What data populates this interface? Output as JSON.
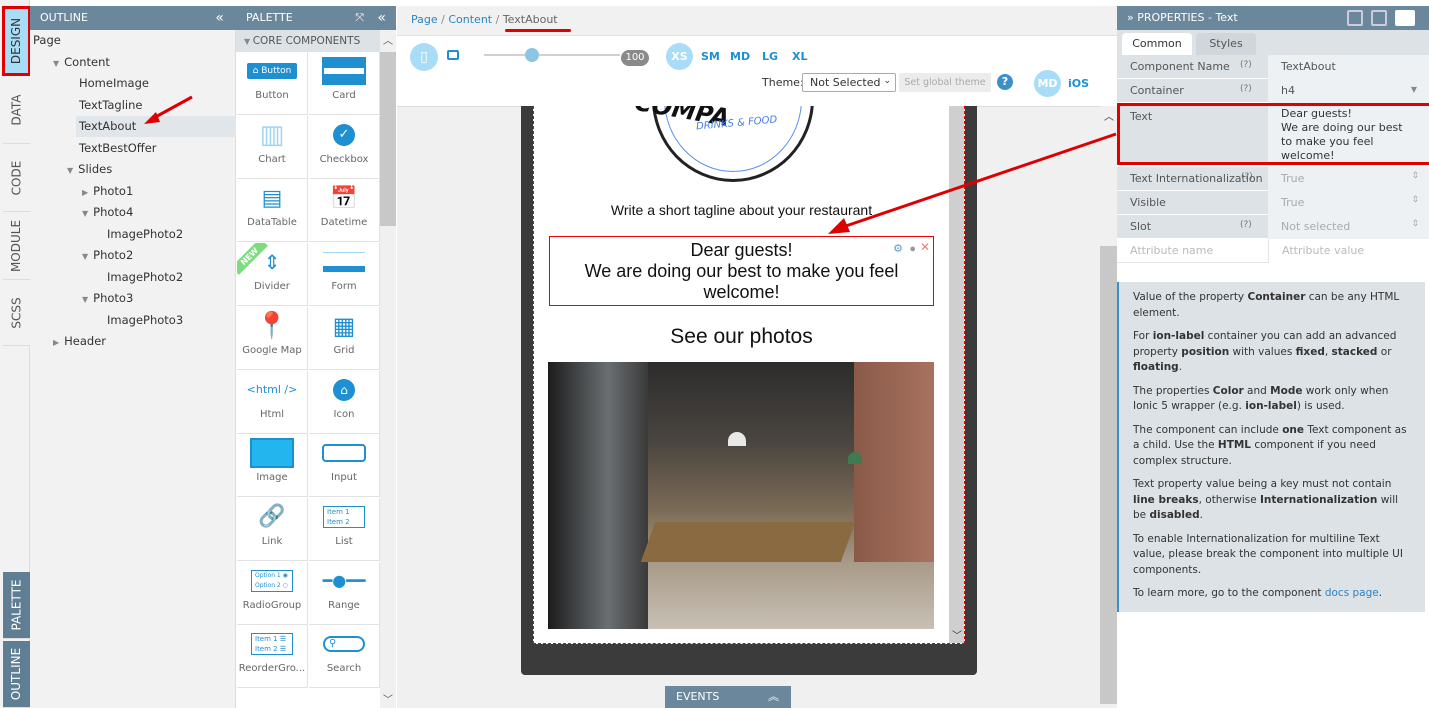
{
  "side_tabs": [
    "DESIGN",
    "DATA",
    "CODE",
    "MODULE",
    "SCSS"
  ],
  "bottom_tabs": [
    "PALETTE",
    "OUTLINE"
  ],
  "outline": {
    "title": "OUTLINE",
    "collapse": "«",
    "items": [
      {
        "label": "Page"
      },
      {
        "label": "Content"
      },
      {
        "label": "HomeImage"
      },
      {
        "label": "TextTagline"
      },
      {
        "label": "TextAbout"
      },
      {
        "label": "TextBestOffer"
      },
      {
        "label": "Slides"
      },
      {
        "label": "Photo1"
      },
      {
        "label": "Photo4"
      },
      {
        "label": "ImagePhoto2"
      },
      {
        "label": "Photo2"
      },
      {
        "label": "ImagePhoto2"
      },
      {
        "label": "Photo3"
      },
      {
        "label": "ImagePhoto3"
      },
      {
        "label": "Header"
      }
    ]
  },
  "palette": {
    "title": "PALETTE",
    "section": "CORE COMPONENTS",
    "items": [
      "Button",
      "Card",
      "Chart",
      "Checkbox",
      "DataTable",
      "Datetime",
      "Divider",
      "Form",
      "Google Map",
      "Grid",
      "Html",
      "Icon",
      "Image",
      "Input",
      "Link",
      "List",
      "RadioGroup",
      "Range",
      "ReorderGro...",
      "Search"
    ],
    "new_badge": "NEW",
    "html_glyph": "<html />",
    "button_glyph": "Button"
  },
  "breadcrumb": [
    "Page",
    "Content",
    "TextAbout"
  ],
  "toolbar": {
    "zoom": "100",
    "zoom_fraction": 0.35,
    "sizes": [
      "XS",
      "SM",
      "MD",
      "LG",
      "XL"
    ],
    "theme_label": "Theme:",
    "theme_value": "Not Selected",
    "set_theme": "Set global theme",
    "modes": [
      "MD",
      "iOS"
    ]
  },
  "canvas": {
    "logo_sub": "DRINKS & FOOD",
    "tagline": "Write a short tagline about your restaurant",
    "about_line1": "Dear guests!",
    "about_line2": "We are doing our best to make you feel welcome!",
    "photos_heading": "See our photos"
  },
  "events": "EVENTS",
  "properties": {
    "title": "PROPERTIES - Text",
    "tabs": [
      "Common",
      "Styles"
    ],
    "rows": [
      {
        "label": "Component Name",
        "help": "(?)",
        "value": "TextAbout"
      },
      {
        "label": "Container",
        "help": "(?)",
        "value": "h4"
      },
      {
        "label": "Text",
        "value": "Dear guests!\nWe are doing our best to make you feel welcome!"
      },
      {
        "label": "Text Internationalization",
        "help": "(?)",
        "value": "True"
      },
      {
        "label": "Visible",
        "value": "True"
      },
      {
        "label": "Slot",
        "help": "(?)",
        "value": "Not selected"
      }
    ],
    "attr_name_placeholder": "Attribute name",
    "attr_value_placeholder": "Attribute value"
  },
  "help": {
    "p1": [
      "Value of the property ",
      "Container",
      " can be any HTML element."
    ],
    "p2": [
      "For ",
      "ion-label",
      " container you can add an advanced property ",
      "position",
      " with values ",
      "fixed",
      ", ",
      "stacked",
      " or ",
      "floating",
      "."
    ],
    "p3": [
      "The properties ",
      "Color",
      " and ",
      "Mode",
      " work only when Ionic 5 wrapper (e.g. ",
      "ion-label",
      ") is used."
    ],
    "p4": [
      "The component can include ",
      "one",
      " Text component as a child. Use the ",
      "HTML",
      " component if you need complex structure."
    ],
    "p5": [
      "Text property value being a key must not contain ",
      "line breaks",
      ", otherwise ",
      "Internationalization",
      " will be ",
      "disabled",
      "."
    ],
    "p6": "To enable Internationalization for multiline Text value, please break the component into multiple UI components.",
    "p7": [
      "To learn more, go to the component ",
      "docs page",
      "."
    ]
  },
  "colors": {
    "header": "#6b879c",
    "accent": "#2a84c6",
    "highlight": "#e00000"
  }
}
